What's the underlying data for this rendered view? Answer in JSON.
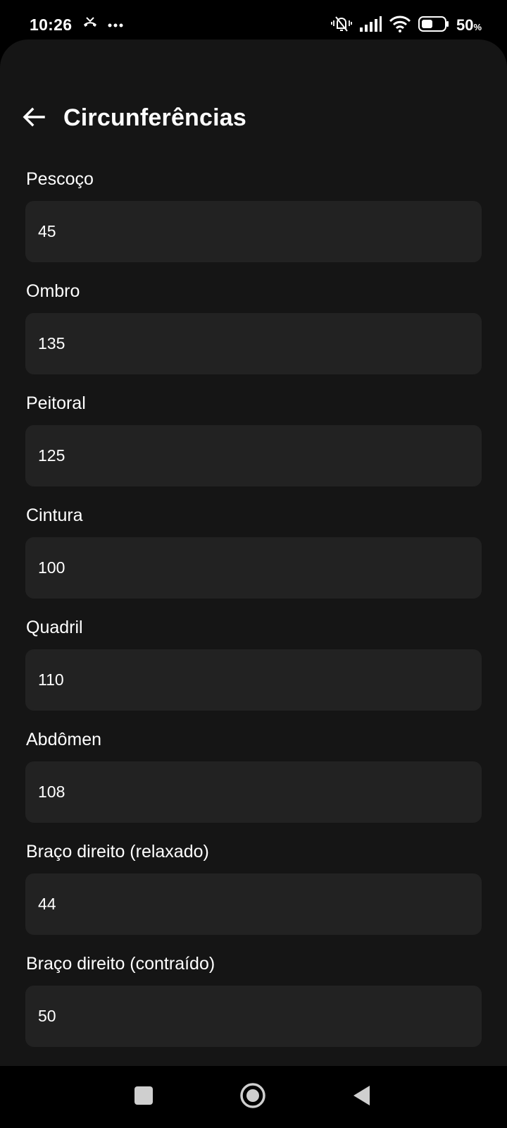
{
  "status": {
    "time": "10:26",
    "battery": "50",
    "battery_unit": "%",
    "icons": [
      "missed-call-icon",
      "more-dots-icon",
      "vibrate-off-icon",
      "signal-icon",
      "wifi-icon",
      "battery-icon"
    ]
  },
  "header": {
    "title": "Circunferências",
    "back_icon": "arrow-left-icon"
  },
  "fields": [
    {
      "label": "Pescoço",
      "value": "45"
    },
    {
      "label": "Ombro",
      "value": "135"
    },
    {
      "label": "Peitoral",
      "value": "125"
    },
    {
      "label": "Cintura",
      "value": "100"
    },
    {
      "label": "Quadril",
      "value": "110"
    },
    {
      "label": "Abdômen",
      "value": "108"
    },
    {
      "label": "Braço direito (relaxado)",
      "value": "44"
    },
    {
      "label": "Braço direito (contraído)",
      "value": "50"
    }
  ],
  "colors": {
    "background": "#151515",
    "input_background": "#222222",
    "text": "#ffffff"
  },
  "nav": {
    "icons": [
      "recents-square-icon",
      "home-circle-icon",
      "back-triangle-icon"
    ]
  }
}
